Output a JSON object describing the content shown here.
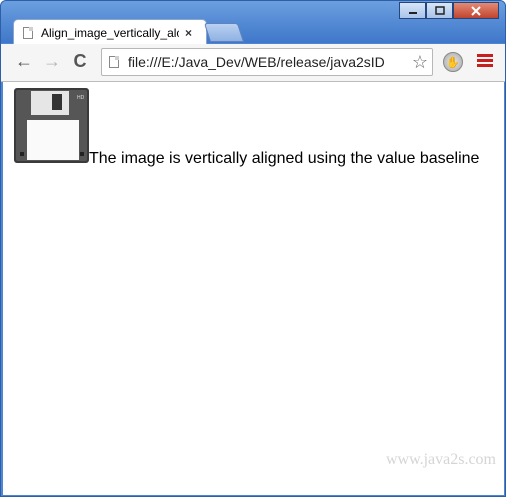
{
  "browser": {
    "tab": {
      "title": "Align_image_vertically_alc",
      "close_glyph": "×",
      "page_icon": "page-icon"
    },
    "nav": {
      "back_glyph": "←",
      "forward_glyph": "→",
      "reload_glyph": "C"
    },
    "address": {
      "url": "file:///E:/Java_Dev/WEB/release/java2sID",
      "star_glyph": "☆"
    },
    "extension_icon": "hand-icon",
    "menu_icon": "hamburger-menu-icon"
  },
  "page": {
    "image_icon": "floppy-disk-icon",
    "text": "The image is vertically aligned using the value baseline",
    "watermark": "www.java2s.com"
  },
  "colors": {
    "titlebar": "#4f86d3",
    "menu_icon": "#c81e1e"
  }
}
